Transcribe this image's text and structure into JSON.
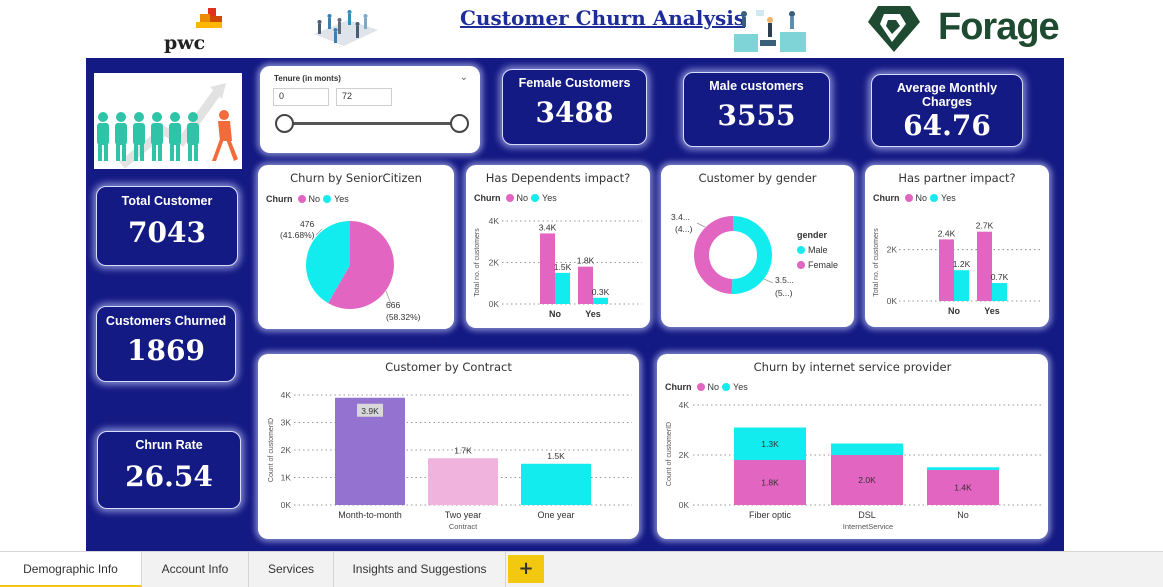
{
  "header": {
    "title": "Customer Churn Analysis",
    "pwc_logo_text": "pwc",
    "forage_logo_text": "Forage"
  },
  "colors": {
    "no": "#e365c2",
    "yes": "#13ecee",
    "canvas": "#141a84",
    "contract_m2m": "#9372d0",
    "contract_two": "#f0b3dd",
    "contract_one": "#13ecee"
  },
  "slicer": {
    "label": "Tenure (in monts)",
    "min_value": "0",
    "max_value": "72"
  },
  "kpis": {
    "female": {
      "label": "Female Customers",
      "value": "3488"
    },
    "male": {
      "label": "Male customers",
      "value": "3555"
    },
    "avg_charges": {
      "label": "Average Monthly Charges",
      "value": "64.76"
    },
    "total": {
      "label": "Total Customer",
      "value": "7043"
    },
    "churned": {
      "label": "Customers Churned",
      "value": "1869"
    },
    "rate": {
      "label": "Chrun Rate",
      "value": "26.54"
    }
  },
  "legend": {
    "churn_label": "Churn",
    "no_label": "No",
    "yes_label": "Yes",
    "gender_label": "gender",
    "male_label": "Male",
    "female_label": "Female"
  },
  "chart_data": [
    {
      "id": "senior",
      "type": "pie",
      "title": "Churn by SeniorCitizen",
      "slices": [
        {
          "name": "No",
          "value": 666,
          "label": "666",
          "pct": "(58.32%)"
        },
        {
          "name": "Yes",
          "value": 476,
          "label": "476",
          "pct": "(41.68%)"
        }
      ]
    },
    {
      "id": "dependents",
      "type": "bar",
      "title": "Has Dependents impact?",
      "ylabel": "Total no. of customers",
      "ylim": [
        0,
        4000
      ],
      "yticks": [
        "0K",
        "2K",
        "4K"
      ],
      "categories": [
        "No",
        "Yes"
      ],
      "series": [
        {
          "name": "No",
          "values": [
            3400,
            1800
          ],
          "labels": [
            "3.4K",
            "1.8K"
          ]
        },
        {
          "name": "Yes",
          "values": [
            1500,
            300
          ],
          "labels": [
            "1.5K",
            "0.3K"
          ]
        }
      ]
    },
    {
      "id": "gender",
      "type": "pie",
      "title": "Customer by gender",
      "slices": [
        {
          "name": "Male",
          "value": 3555,
          "label": "3.5...",
          "pct": "(5...)"
        },
        {
          "name": "Female",
          "value": 3488,
          "label": "3.4...",
          "pct": "(4...)"
        }
      ]
    },
    {
      "id": "partner",
      "type": "bar",
      "title": "Has partner impact?",
      "ylabel": "Total no. of customers",
      "ylim": [
        0,
        3000
      ],
      "yticks": [
        "0K",
        "2K"
      ],
      "categories": [
        "No",
        "Yes"
      ],
      "series": [
        {
          "name": "No",
          "values": [
            2400,
            2700
          ],
          "labels": [
            "2.4K",
            "2.7K"
          ]
        },
        {
          "name": "Yes",
          "values": [
            1200,
            700
          ],
          "labels": [
            "1.2K",
            "0.7K"
          ]
        }
      ]
    },
    {
      "id": "contract",
      "type": "bar",
      "title": "Customer by Contract",
      "xlabel": "Contract",
      "ylabel": "Count of customerID",
      "ylim": [
        0,
        4000
      ],
      "yticks": [
        "0K",
        "1K",
        "2K",
        "3K",
        "4K"
      ],
      "categories": [
        "Month-to-month",
        "Two year",
        "One year"
      ],
      "values": [
        3900,
        1700,
        1500
      ],
      "labels": [
        "3.9K",
        "1.7K",
        "1.5K"
      ]
    },
    {
      "id": "internet",
      "type": "bar",
      "title": "Churn by internet service provider",
      "xlabel": "InternetService",
      "ylabel": "Count of customerID",
      "ylim": [
        0,
        4000
      ],
      "yticks": [
        "0K",
        "2K",
        "4K"
      ],
      "categories": [
        "Fiber optic",
        "DSL",
        "No"
      ],
      "series": [
        {
          "name": "No",
          "values": [
            1800,
            2000,
            1400
          ],
          "labels": [
            "1.8K",
            "2.0K",
            "1.4K"
          ]
        },
        {
          "name": "Yes",
          "values": [
            1300,
            460,
            110
          ],
          "labels": [
            "1.3K",
            "",
            ""
          ]
        }
      ]
    }
  ],
  "tabs": [
    {
      "label": "Demographic Info",
      "active": true
    },
    {
      "label": "Account Info"
    },
    {
      "label": "Services"
    },
    {
      "label": "Insights and Suggestions"
    }
  ],
  "tab_add_label": "+"
}
